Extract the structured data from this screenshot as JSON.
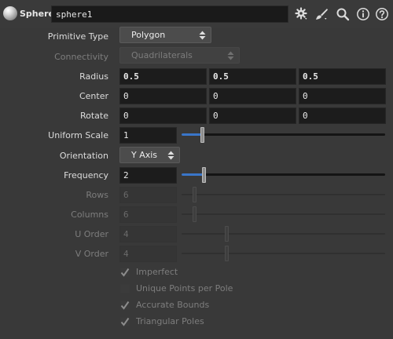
{
  "header": {
    "node_type": "Sphere",
    "node_name": "sphere1",
    "icons": [
      "gear-icon",
      "brush-icon",
      "search-icon",
      "info-icon",
      "help-icon"
    ]
  },
  "params": {
    "primitive_type": {
      "label": "Primitive Type",
      "value": "Polygon"
    },
    "connectivity": {
      "label": "Connectivity",
      "value": "Quadrilaterals"
    },
    "radius": {
      "label": "Radius",
      "x": "0.5",
      "y": "0.5",
      "z": "0.5"
    },
    "center": {
      "label": "Center",
      "x": "0",
      "y": "0",
      "z": "0"
    },
    "rotate": {
      "label": "Rotate",
      "x": "0",
      "y": "0",
      "z": "0"
    },
    "uniform_scale": {
      "label": "Uniform Scale",
      "value": "1",
      "slider_level": 0.1
    },
    "orientation": {
      "label": "Orientation",
      "value": "Y Axis"
    },
    "frequency": {
      "label": "Frequency",
      "value": "2",
      "slider_level": 0.11
    },
    "rows": {
      "label": "Rows",
      "value": "6",
      "slider_level": 0.06
    },
    "columns": {
      "label": "Columns",
      "value": "6",
      "slider_level": 0.06
    },
    "u_order": {
      "label": "U Order",
      "value": "4",
      "slider_level": 0.22
    },
    "v_order": {
      "label": "V Order",
      "value": "4",
      "slider_level": 0.22
    },
    "imperfect": {
      "label": "Imperfect",
      "checked": true
    },
    "unique_points_per_pole": {
      "label": "Unique Points per Pole",
      "checked": false
    },
    "accurate_bounds": {
      "label": "Accurate Bounds",
      "checked": true
    },
    "triangular_poles": {
      "label": "Triangular Poles",
      "checked": true
    }
  },
  "colors": {
    "background": "#393939",
    "field": "#1c1c1c",
    "slider_fill": "#3a76c9"
  }
}
